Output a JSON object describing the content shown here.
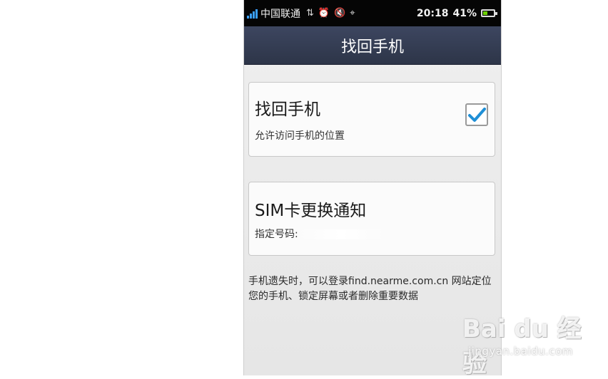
{
  "status_bar": {
    "carrier": "中国联通",
    "icons": [
      "signal-icon",
      "data-icon",
      "alarm-icon",
      "mute-icon",
      "gps-icon"
    ],
    "time": "20:18",
    "battery_percent": "41%",
    "battery_level": 0.41
  },
  "header": {
    "title": "找回手机"
  },
  "settings": [
    {
      "title": "找回手机",
      "subtitle": "允许访问手机的位置",
      "checked": true
    },
    {
      "title": "SIM卡更换通知",
      "subtitle": "指定号码:"
    }
  ],
  "info_text": "手机遗失时，可以登录find.nearme.com.cn 网站定位您的手机、锁定屏幕或者删除重要数据",
  "watermark": {
    "logo": "Bai du 经验",
    "url": "jingyan.baidu.com"
  },
  "colors": {
    "accent_check": "#1f8fd6",
    "titlebar": "#363e55",
    "battery": "#6cd000"
  }
}
